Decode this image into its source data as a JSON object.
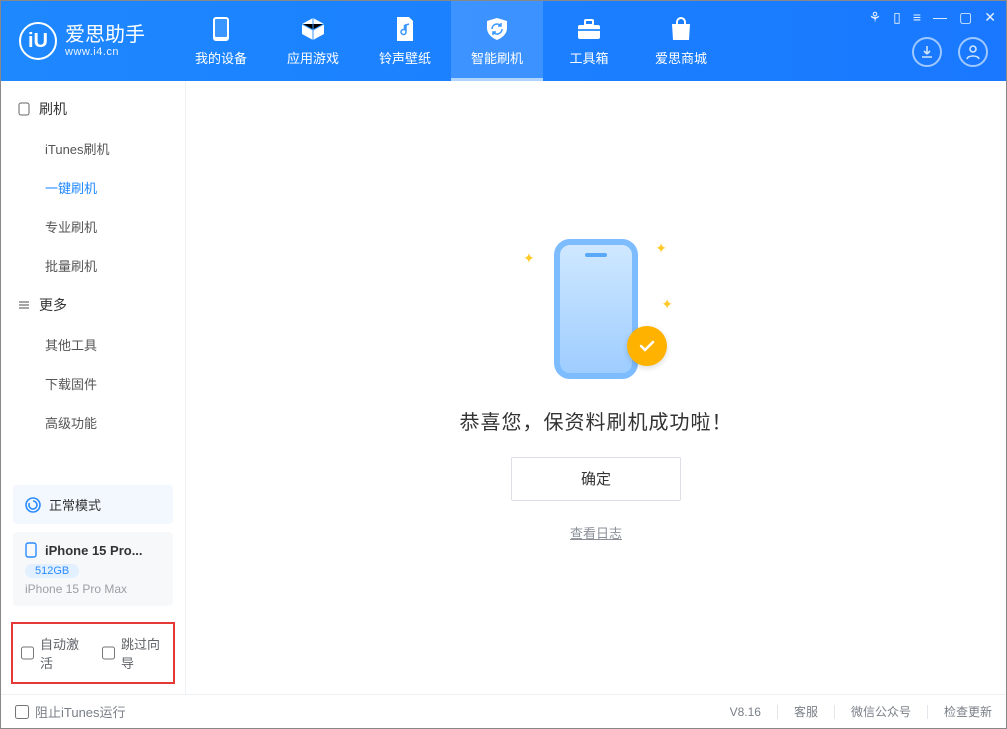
{
  "brand": {
    "title": "爱思助手",
    "site": "www.i4.cn"
  },
  "nav": {
    "items": [
      {
        "label": "我的设备"
      },
      {
        "label": "应用游戏"
      },
      {
        "label": "铃声壁纸"
      },
      {
        "label": "智能刷机"
      },
      {
        "label": "工具箱"
      },
      {
        "label": "爱思商城"
      }
    ],
    "active_index": 3
  },
  "sidebar": {
    "sections": [
      {
        "title": "刷机",
        "items": [
          {
            "label": "iTunes刷机"
          },
          {
            "label": "一键刷机"
          },
          {
            "label": "专业刷机"
          },
          {
            "label": "批量刷机"
          }
        ],
        "active_index": 1
      },
      {
        "title": "更多",
        "items": [
          {
            "label": "其他工具"
          },
          {
            "label": "下载固件"
          },
          {
            "label": "高级功能"
          }
        ],
        "active_index": -1
      }
    ]
  },
  "status": {
    "label": "正常模式"
  },
  "device": {
    "name": "iPhone 15 Pro...",
    "capacity": "512GB",
    "model": "iPhone 15 Pro Max"
  },
  "options": {
    "auto_activate": "自动激活",
    "skip_wizard": "跳过向导"
  },
  "main": {
    "message": "恭喜您，保资料刷机成功啦！",
    "ok": "确定",
    "view_log": "查看日志"
  },
  "footer": {
    "block_itunes": "阻止iTunes运行",
    "version": "V8.16",
    "support": "客服",
    "wechat": "微信公众号",
    "update": "检查更新"
  }
}
